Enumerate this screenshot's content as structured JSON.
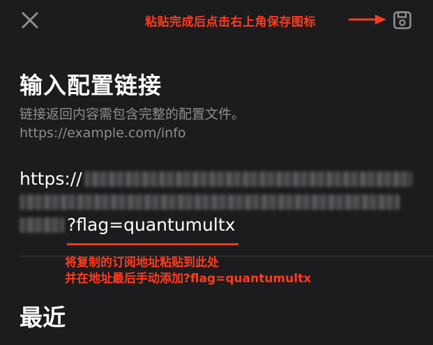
{
  "header": {
    "close_icon": "close-icon",
    "save_icon": "floppy-disk-icon",
    "annotation": "粘贴完成后点击右上角保存图标"
  },
  "main": {
    "title": "输入配置链接",
    "description_line1": "链接返回内容需包含完整的配置文件。",
    "description_line2": "https://example.com/info",
    "link_prefix": "https://",
    "link_suffix": "?flag=quantumultx"
  },
  "annotation_bottom": {
    "line1": "将复制的订阅地址粘贴到此处",
    "line2": "并在地址最后手动添加?flag=quantumultx"
  },
  "recent": {
    "heading": "最近"
  },
  "colors": {
    "background": "#1c1c1e",
    "annotation": "#ff3b1f",
    "secondary_text": "#8e8e93"
  }
}
